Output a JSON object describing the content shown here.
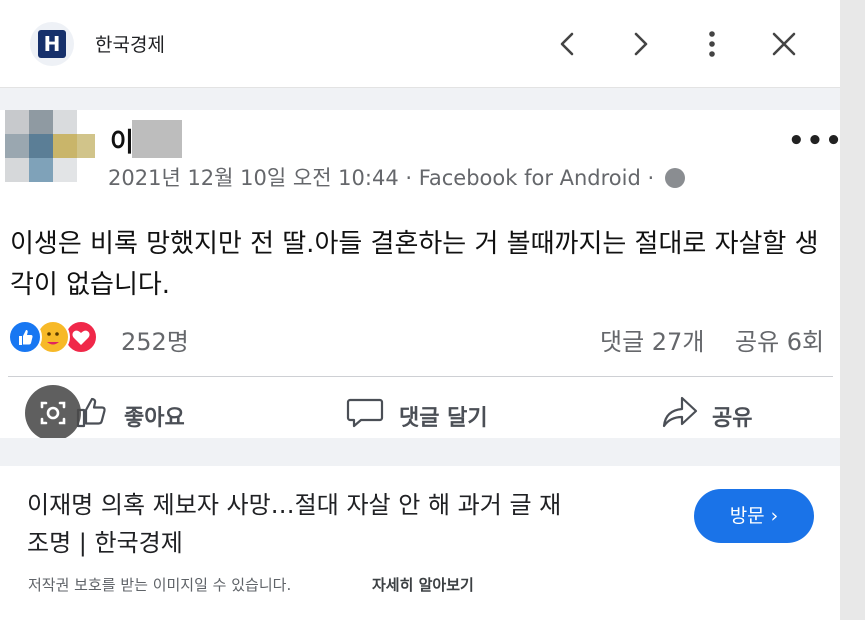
{
  "header": {
    "logo_letter": "H",
    "site_name": "한국경제",
    "icons": [
      "chevron-left-icon",
      "chevron-right-icon",
      "more-vert-icon",
      "close-icon"
    ]
  },
  "post": {
    "poster_name": "이",
    "meta": "2021년 12월 10일 오전 10:44 · Facebook for Android ·",
    "text_line1": "이생은 비록 망했지만 전 딸.아들 결혼하는 거 볼때까지는 절대로 자살할 생",
    "text_line2": "각이 없습니다.",
    "reaction_count": "252명",
    "comments": "댓글 27개",
    "shares": "공유 6회",
    "actions": {
      "like": "좋아요",
      "comment": "댓글 달기",
      "share": "공유"
    }
  },
  "info": {
    "headline_line1": "이재명 의혹 제보자 사망…절대 자살 안 해 과거 글 재",
    "headline_line2": "조명 | 한국경제",
    "visit_label": "방문 ›",
    "copyright": "저작권 보호를 받는 이미지일 수 있습니다.",
    "learn_more": "자세히 알아보기"
  },
  "colors": {
    "accent": "#1a73e8",
    "logo_bg": "#16306b",
    "fb_gray": "#65676b"
  }
}
